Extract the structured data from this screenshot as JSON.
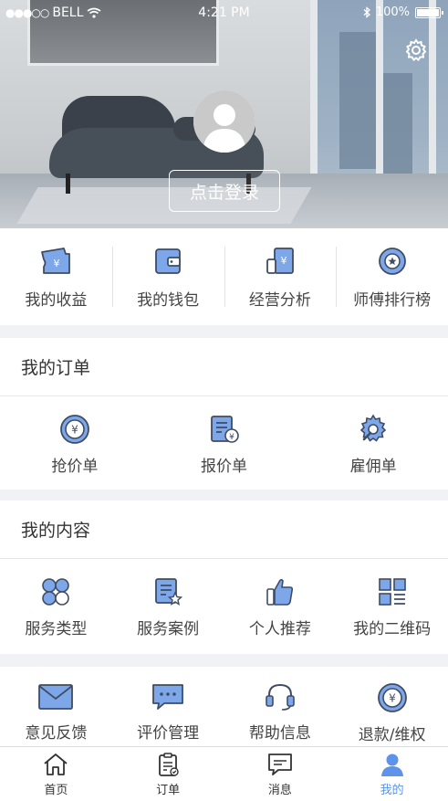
{
  "status_bar": {
    "carrier": "BELL",
    "signal_dots": "●●●○○",
    "time": "4:21 PM",
    "battery": "100%"
  },
  "profile": {
    "login_label": "点击登录"
  },
  "top_grid": [
    {
      "label": "我的收益",
      "icon": "ticket-yen-icon"
    },
    {
      "label": "我的钱包",
      "icon": "wallet-icon"
    },
    {
      "label": "经营分析",
      "icon": "business-analysis-icon"
    },
    {
      "label": "师傅排行榜",
      "icon": "ranking-medal-icon"
    }
  ],
  "orders": {
    "title": "我的订单",
    "items": [
      {
        "label": "抢价单",
        "icon": "yen-coin-icon"
      },
      {
        "label": "报价单",
        "icon": "quote-document-icon"
      },
      {
        "label": "雇佣单",
        "icon": "gear-wrench-icon"
      }
    ]
  },
  "content": {
    "title": "我的内容",
    "items": [
      {
        "label": "服务类型",
        "icon": "categories-icon"
      },
      {
        "label": "服务案例",
        "icon": "case-star-icon"
      },
      {
        "label": "个人推荐",
        "icon": "thumbs-up-icon"
      },
      {
        "label": "我的二维码",
        "icon": "qr-code-icon"
      }
    ]
  },
  "more": [
    {
      "label": "意见反馈",
      "icon": "envelope-icon"
    },
    {
      "label": "评价管理",
      "icon": "chat-bubble-icon"
    },
    {
      "label": "帮助信息",
      "icon": "headset-icon"
    },
    {
      "label": "退款/维权",
      "icon": "refund-coin-icon"
    }
  ],
  "tabs": [
    {
      "label": "首页",
      "icon": "home-icon",
      "active": false
    },
    {
      "label": "订单",
      "icon": "clipboard-icon",
      "active": false
    },
    {
      "label": "消息",
      "icon": "message-icon",
      "active": false
    },
    {
      "label": "我的",
      "icon": "person-icon",
      "active": true
    }
  ],
  "colors": {
    "accent": "#5d93e8",
    "icon_fill": "#7ea7ea",
    "icon_stroke": "#3f4c63"
  }
}
